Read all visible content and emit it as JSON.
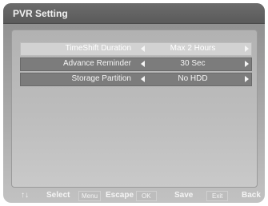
{
  "window": {
    "title": "PVR Setting"
  },
  "settings": [
    {
      "label": "TimeShift Duration",
      "value": "Max 2 Hours",
      "selected": true
    },
    {
      "label": "Advance Reminder",
      "value": "30 Sec",
      "selected": false
    },
    {
      "label": "Storage Partition",
      "value": "No HDD",
      "selected": false
    }
  ],
  "footer": {
    "nav_arrows": "↑↓",
    "select_label": "Select",
    "menu_key": "Menu",
    "escape_label": "Escape",
    "ok_key": "OK",
    "save_label": "Save",
    "exit_key": "Exit",
    "back_label": "Back"
  },
  "icons": {
    "row_left": "arrow-left-icon",
    "row_right": "arrow-right-icon",
    "nav": "up-down-arrows-icon"
  }
}
